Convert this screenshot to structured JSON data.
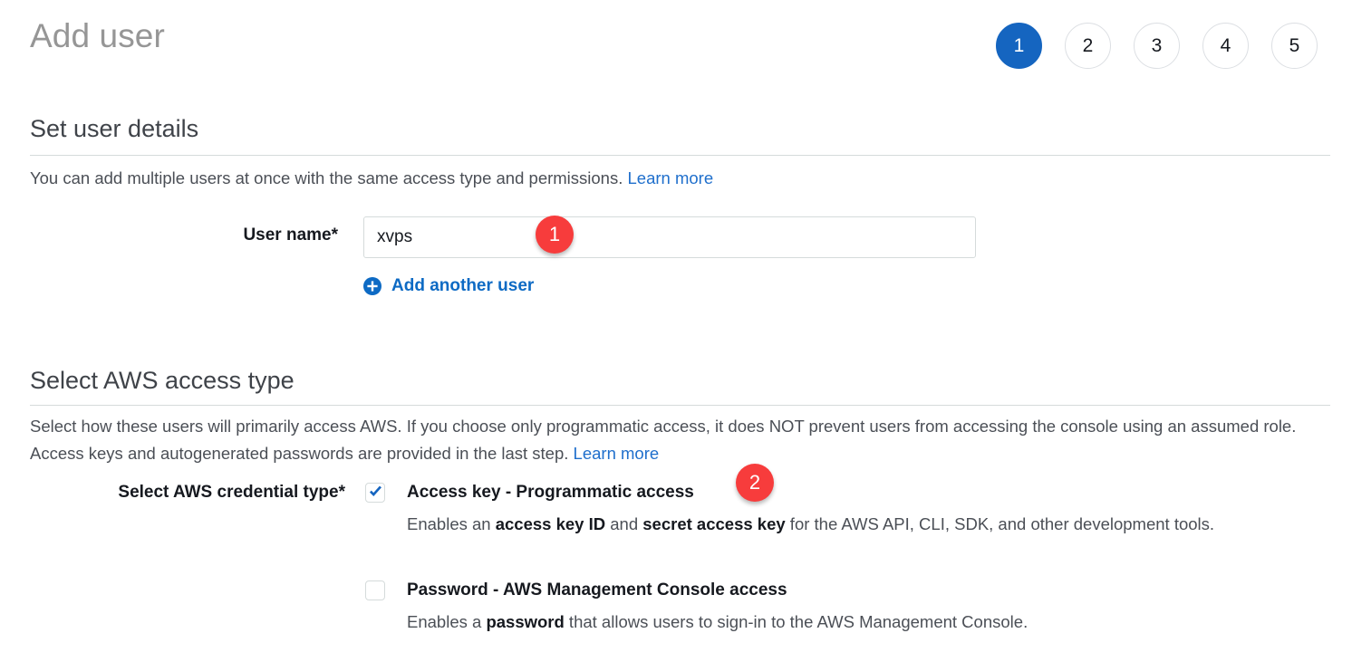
{
  "header": {
    "title": "Add user",
    "steps": [
      {
        "label": "1",
        "active": true
      },
      {
        "label": "2",
        "active": false
      },
      {
        "label": "3",
        "active": false
      },
      {
        "label": "4",
        "active": false
      },
      {
        "label": "5",
        "active": false
      }
    ]
  },
  "user_details": {
    "section_title": "Set user details",
    "description": "You can add multiple users at once with the same access type and permissions.",
    "learn_more_label": "Learn more",
    "user_name_label": "User name*",
    "user_name_value": "xvps",
    "user_name_placeholder": "",
    "add_another_label": "Add another user"
  },
  "access_type": {
    "section_title": "Select AWS access type",
    "description_line1": "Select how these users will primarily access AWS. If you choose only programmatic access, it does NOT prevent users from accessing the console using",
    "description_line2": "an assumed role. Access keys and autogenerated passwords are provided in the last step.",
    "learn_more_label": "Learn more",
    "credential_type_label": "Select AWS credential type*",
    "options": [
      {
        "title": "Access key - Programmatic access",
        "description_prefix": "Enables an ",
        "bold1": "access key ID",
        "description_mid": " and ",
        "bold2": "secret access key",
        "description_suffix": " for the AWS API, CLI, SDK, and other development tools.",
        "checked": true
      },
      {
        "title": "Password - AWS Management Console access",
        "description_prefix": "Enables a ",
        "bold1": "password",
        "description_mid": "",
        "bold2": "",
        "description_suffix": " that allows users to sign-in to the AWS Management Console.",
        "checked": false
      }
    ]
  },
  "annotations": [
    {
      "label": "1"
    },
    {
      "label": "2"
    }
  ],
  "colors": {
    "accent_blue": "#1565c0",
    "link_blue": "#1f6fcc",
    "badge_red": "#f73c3c",
    "title_gray": "#969696"
  }
}
